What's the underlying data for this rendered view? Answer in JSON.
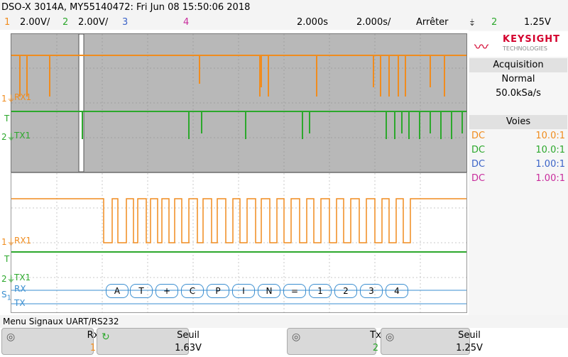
{
  "title": "DSO-X 3014A, MY55140472: Fri Jun 08 15:50:06 2018",
  "channels": [
    {
      "num": "1",
      "scale": "2.00V/",
      "color": "#f08c1e"
    },
    {
      "num": "2",
      "scale": "2.00V/",
      "color": "#2ca82c"
    },
    {
      "num": "3",
      "scale": "",
      "color": "#3c64c8"
    },
    {
      "num": "4",
      "scale": "",
      "color": "#c82c9c"
    }
  ],
  "timebase": {
    "delay": "2.000s",
    "scale": "2.000s/",
    "run_state": "Arrêter"
  },
  "trigger": {
    "icon": "trigger-falling-edge-icon",
    "source": "2",
    "level": "1.25V"
  },
  "labels": {
    "rx1": "RX1",
    "tx1": "TX1",
    "rx1_zoom": "RX1",
    "tx1_zoom": "TX1",
    "bus_rx": "RX",
    "bus_tx": "TX",
    "serial": "S",
    "serial_sub": "1",
    "trigger_mark": "T"
  },
  "decode_rx": [
    "A",
    "T",
    "+",
    "C",
    "P",
    "I",
    "N",
    "=",
    "1",
    "2",
    "3",
    "4"
  ],
  "brand": {
    "name": "KEYSIGHT",
    "sub": "TECHNOLOGIES",
    "color": "#d4002d"
  },
  "acquisition": {
    "header": "Acquisition",
    "mode": "Normal",
    "rate": "50.0kSa/s"
  },
  "voies": {
    "header": "Voies",
    "rows": [
      {
        "coupling": "DC",
        "probe": "10.0:1",
        "color": "#f08c1e"
      },
      {
        "coupling": "DC",
        "probe": "10.0:1",
        "color": "#2ca82c"
      },
      {
        "coupling": "DC",
        "probe": "1.00:1",
        "color": "#3c64c8"
      },
      {
        "coupling": "DC",
        "probe": "1.00:1",
        "color": "#c82c9c"
      }
    ]
  },
  "menu": {
    "title": "Menu Signaux UART/RS232"
  },
  "softkeys": [
    {
      "label": "Rx",
      "value": "1",
      "color": "#f08c1e",
      "icon": "rotary-knob-icon"
    },
    {
      "label": "Seuil",
      "value": "1.63V",
      "color": "#000000",
      "icon": "rotary-knob-active-icon"
    },
    {
      "label": "Tx",
      "value": "2",
      "color": "#2ca82c",
      "icon": "rotary-knob-icon"
    },
    {
      "label": "Seuil",
      "value": "1.25V",
      "color": "#000000",
      "icon": "rotary-knob-icon"
    }
  ]
}
